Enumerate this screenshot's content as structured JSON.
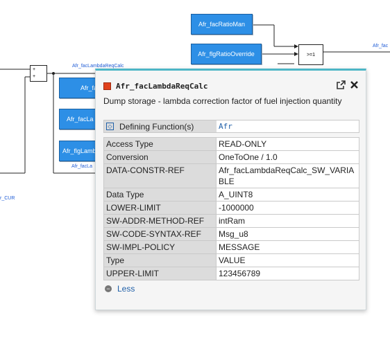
{
  "diagram": {
    "blocks": [
      {
        "name": "block-fac-ratio-man",
        "label": "Afr_facRatioMan"
      },
      {
        "name": "block-flg-ratio-override",
        "label": "Afr_flgRatioOverride"
      },
      {
        "name": "block-fac-partial-1",
        "label": "Afr_fac"
      },
      {
        "name": "block-fac-partial-2",
        "label": "Afr_facLa"
      },
      {
        "name": "block-flg-partial",
        "label": "Afr_flgLamb"
      }
    ],
    "signals": {
      "lambda_req": "Afr_facLambdaReqCalc",
      "right_edge": "Afr_fac",
      "left_cur": "r_CUR",
      "bottom_partial": "Afr_facLa"
    },
    "gate_label": ">=1",
    "sum_plus_1": "+",
    "sum_plus_2": "+"
  },
  "popup": {
    "title": "Afr_facLambdaReqCalc",
    "description": "Dump storage - lambda correction factor of fuel injection quantity",
    "defining_function": {
      "label": "Defining Function(s)",
      "value": "Afr"
    },
    "properties": [
      {
        "key": "Access Type",
        "value": "READ-ONLY"
      },
      {
        "key": "Conversion",
        "value": "OneToOne / 1.0"
      },
      {
        "key": "DATA-CONSTR-REF",
        "value": "Afr_facLambdaReqCalc_SW_VARIABLE"
      },
      {
        "key": "Data Type",
        "value": "A_UINT8"
      },
      {
        "key": "LOWER-LIMIT",
        "value": "-1000000"
      },
      {
        "key": "SW-ADDR-METHOD-REF",
        "value": "intRam"
      },
      {
        "key": "SW-CODE-SYNTAX-REF",
        "value": "Msg_u8"
      },
      {
        "key": "SW-IMPL-POLICY",
        "value": "MESSAGE"
      },
      {
        "key": "Type",
        "value": "VALUE"
      },
      {
        "key": "UPPER-LIMIT",
        "value": "123456789"
      }
    ],
    "less_label": "Less",
    "colors": {
      "accent": "#4db6c6",
      "block": "#2d8fe6",
      "signal": "#1e5bd6",
      "title_icon": "#e0421c"
    }
  }
}
